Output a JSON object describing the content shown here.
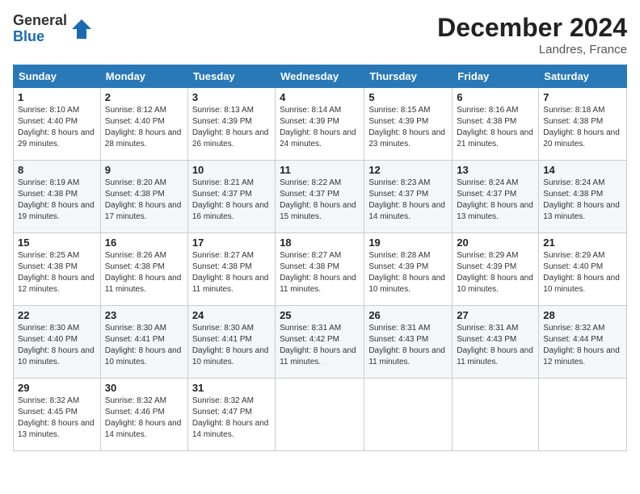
{
  "logo": {
    "general": "General",
    "blue": "Blue"
  },
  "title": "December 2024",
  "location": "Landres, France",
  "days_header": [
    "Sunday",
    "Monday",
    "Tuesday",
    "Wednesday",
    "Thursday",
    "Friday",
    "Saturday"
  ],
  "weeks": [
    [
      {
        "day": "1",
        "sunrise": "8:10 AM",
        "sunset": "4:40 PM",
        "daylight": "8 hours and 29 minutes."
      },
      {
        "day": "2",
        "sunrise": "8:12 AM",
        "sunset": "4:40 PM",
        "daylight": "8 hours and 28 minutes."
      },
      {
        "day": "3",
        "sunrise": "8:13 AM",
        "sunset": "4:39 PM",
        "daylight": "8 hours and 26 minutes."
      },
      {
        "day": "4",
        "sunrise": "8:14 AM",
        "sunset": "4:39 PM",
        "daylight": "8 hours and 24 minutes."
      },
      {
        "day": "5",
        "sunrise": "8:15 AM",
        "sunset": "4:39 PM",
        "daylight": "8 hours and 23 minutes."
      },
      {
        "day": "6",
        "sunrise": "8:16 AM",
        "sunset": "4:38 PM",
        "daylight": "8 hours and 21 minutes."
      },
      {
        "day": "7",
        "sunrise": "8:18 AM",
        "sunset": "4:38 PM",
        "daylight": "8 hours and 20 minutes."
      }
    ],
    [
      {
        "day": "8",
        "sunrise": "8:19 AM",
        "sunset": "4:38 PM",
        "daylight": "8 hours and 19 minutes."
      },
      {
        "day": "9",
        "sunrise": "8:20 AM",
        "sunset": "4:38 PM",
        "daylight": "8 hours and 17 minutes."
      },
      {
        "day": "10",
        "sunrise": "8:21 AM",
        "sunset": "4:37 PM",
        "daylight": "8 hours and 16 minutes."
      },
      {
        "day": "11",
        "sunrise": "8:22 AM",
        "sunset": "4:37 PM",
        "daylight": "8 hours and 15 minutes."
      },
      {
        "day": "12",
        "sunrise": "8:23 AM",
        "sunset": "4:37 PM",
        "daylight": "8 hours and 14 minutes."
      },
      {
        "day": "13",
        "sunrise": "8:24 AM",
        "sunset": "4:37 PM",
        "daylight": "8 hours and 13 minutes."
      },
      {
        "day": "14",
        "sunrise": "8:24 AM",
        "sunset": "4:38 PM",
        "daylight": "8 hours and 13 minutes."
      }
    ],
    [
      {
        "day": "15",
        "sunrise": "8:25 AM",
        "sunset": "4:38 PM",
        "daylight": "8 hours and 12 minutes."
      },
      {
        "day": "16",
        "sunrise": "8:26 AM",
        "sunset": "4:38 PM",
        "daylight": "8 hours and 11 minutes."
      },
      {
        "day": "17",
        "sunrise": "8:27 AM",
        "sunset": "4:38 PM",
        "daylight": "8 hours and 11 minutes."
      },
      {
        "day": "18",
        "sunrise": "8:27 AM",
        "sunset": "4:38 PM",
        "daylight": "8 hours and 11 minutes."
      },
      {
        "day": "19",
        "sunrise": "8:28 AM",
        "sunset": "4:39 PM",
        "daylight": "8 hours and 10 minutes."
      },
      {
        "day": "20",
        "sunrise": "8:29 AM",
        "sunset": "4:39 PM",
        "daylight": "8 hours and 10 minutes."
      },
      {
        "day": "21",
        "sunrise": "8:29 AM",
        "sunset": "4:40 PM",
        "daylight": "8 hours and 10 minutes."
      }
    ],
    [
      {
        "day": "22",
        "sunrise": "8:30 AM",
        "sunset": "4:40 PM",
        "daylight": "8 hours and 10 minutes."
      },
      {
        "day": "23",
        "sunrise": "8:30 AM",
        "sunset": "4:41 PM",
        "daylight": "8 hours and 10 minutes."
      },
      {
        "day": "24",
        "sunrise": "8:30 AM",
        "sunset": "4:41 PM",
        "daylight": "8 hours and 10 minutes."
      },
      {
        "day": "25",
        "sunrise": "8:31 AM",
        "sunset": "4:42 PM",
        "daylight": "8 hours and 11 minutes."
      },
      {
        "day": "26",
        "sunrise": "8:31 AM",
        "sunset": "4:43 PM",
        "daylight": "8 hours and 11 minutes."
      },
      {
        "day": "27",
        "sunrise": "8:31 AM",
        "sunset": "4:43 PM",
        "daylight": "8 hours and 11 minutes."
      },
      {
        "day": "28",
        "sunrise": "8:32 AM",
        "sunset": "4:44 PM",
        "daylight": "8 hours and 12 minutes."
      }
    ],
    [
      {
        "day": "29",
        "sunrise": "8:32 AM",
        "sunset": "4:45 PM",
        "daylight": "8 hours and 13 minutes."
      },
      {
        "day": "30",
        "sunrise": "8:32 AM",
        "sunset": "4:46 PM",
        "daylight": "8 hours and 14 minutes."
      },
      {
        "day": "31",
        "sunrise": "8:32 AM",
        "sunset": "4:47 PM",
        "daylight": "8 hours and 14 minutes."
      },
      null,
      null,
      null,
      null
    ]
  ]
}
